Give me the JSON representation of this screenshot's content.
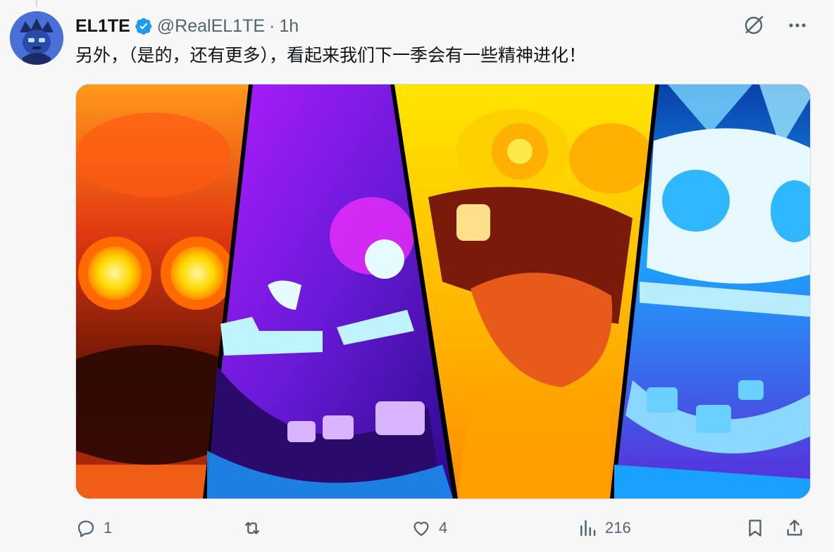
{
  "tweet": {
    "display_name": "EL1TE",
    "handle": "@RealEL1TE",
    "separator": "·",
    "time": "1h",
    "text": "另外，（是的，还有更多），看起来我们下一季会有一些精神进化！",
    "verified_color": "#1d9bf0"
  },
  "header_actions": {
    "grok_icon": "grok-icon",
    "more_icon": "more-icon"
  },
  "media": {
    "panels": [
      "fire-spirit",
      "purple-spirit",
      "yellow-spirit",
      "ice-spirit"
    ]
  },
  "actions": {
    "reply_count": "1",
    "retweet_count": "",
    "like_count": "4",
    "views_count": "216"
  },
  "colors": {
    "text_primary": "#0f1419",
    "text_secondary": "#536471",
    "background": "#f7f7f7"
  }
}
